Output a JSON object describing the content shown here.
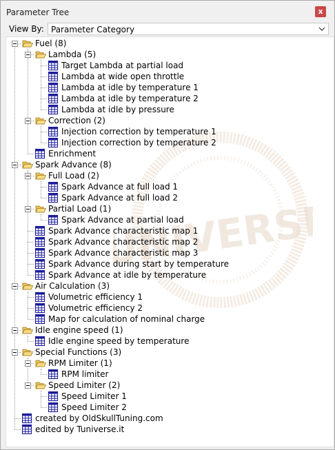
{
  "window": {
    "title": "Parameter Tree",
    "close_label": "x"
  },
  "view_by": {
    "label": "View By:",
    "selected": "Parameter Category"
  },
  "tree": [
    {
      "label": "Fuel (8)",
      "level": 0,
      "type": "folder"
    },
    {
      "label": "Lambda (5)",
      "level": 1,
      "type": "folder"
    },
    {
      "label": "Target Lambda at partial load",
      "level": 2,
      "type": "table"
    },
    {
      "label": "Lambda at wide open throttle",
      "level": 2,
      "type": "table"
    },
    {
      "label": "Lambda at idle by temperature 1",
      "level": 2,
      "type": "table"
    },
    {
      "label": "Lambda at idle by temperature 2",
      "level": 2,
      "type": "table"
    },
    {
      "label": "Lambda at idle by pressure",
      "level": 2,
      "type": "table"
    },
    {
      "label": "Correction (2)",
      "level": 1,
      "type": "folder"
    },
    {
      "label": "Injection correction by temperature 1",
      "level": 2,
      "type": "table"
    },
    {
      "label": "Injection correction by temperature 2",
      "level": 2,
      "type": "table"
    },
    {
      "label": "Enrichment",
      "level": 1,
      "type": "table"
    },
    {
      "label": "Spark Advance (8)",
      "level": 0,
      "type": "folder"
    },
    {
      "label": "Full Load (2)",
      "level": 1,
      "type": "folder"
    },
    {
      "label": "Spark Advance at full load 1",
      "level": 2,
      "type": "table"
    },
    {
      "label": "Spark Advance at full load 2",
      "level": 2,
      "type": "table"
    },
    {
      "label": "Partial Load (1)",
      "level": 1,
      "type": "folder"
    },
    {
      "label": "Spark Advance at partial load",
      "level": 2,
      "type": "table"
    },
    {
      "label": "Spark Advance characteristic map 1",
      "level": 1,
      "type": "table"
    },
    {
      "label": "Spark Advance characteristic map 2",
      "level": 1,
      "type": "table"
    },
    {
      "label": "Spark Advance characteristic map 3",
      "level": 1,
      "type": "table"
    },
    {
      "label": "Spark Advance during start by temperature",
      "level": 1,
      "type": "table"
    },
    {
      "label": "Spark Advance at idle by temperature",
      "level": 1,
      "type": "table"
    },
    {
      "label": "Air Calculation (3)",
      "level": 0,
      "type": "folder"
    },
    {
      "label": "Volumetric efficiency 1",
      "level": 1,
      "type": "table"
    },
    {
      "label": "Volumetric efficiency 2",
      "level": 1,
      "type": "table"
    },
    {
      "label": "Map for calculation of nominal charge",
      "level": 1,
      "type": "table"
    },
    {
      "label": "Idle engine speed (1)",
      "level": 0,
      "type": "folder"
    },
    {
      "label": "Idle engine speed by temperature",
      "level": 1,
      "type": "table"
    },
    {
      "label": "Special Functions (3)",
      "level": 0,
      "type": "folder"
    },
    {
      "label": "RPM Limiter (1)",
      "level": 1,
      "type": "folder"
    },
    {
      "label": "RPM limiter",
      "level": 2,
      "type": "table"
    },
    {
      "label": "Speed Limiter (2)",
      "level": 1,
      "type": "folder"
    },
    {
      "label": "Speed Limiter 1",
      "level": 2,
      "type": "table"
    },
    {
      "label": "Speed Limiter 2",
      "level": 2,
      "type": "table"
    },
    {
      "label": "created by OldSkullTuning.com",
      "level": 0,
      "type": "table"
    },
    {
      "label": "edited by Tuniverse.it",
      "level": 0,
      "type": "table"
    }
  ],
  "watermark": {
    "text": "TUNIVERSE"
  },
  "colors": {
    "folder": "#e8c35a",
    "folder_edge": "#a07a1c",
    "table_icon": "#1c1c9a"
  }
}
